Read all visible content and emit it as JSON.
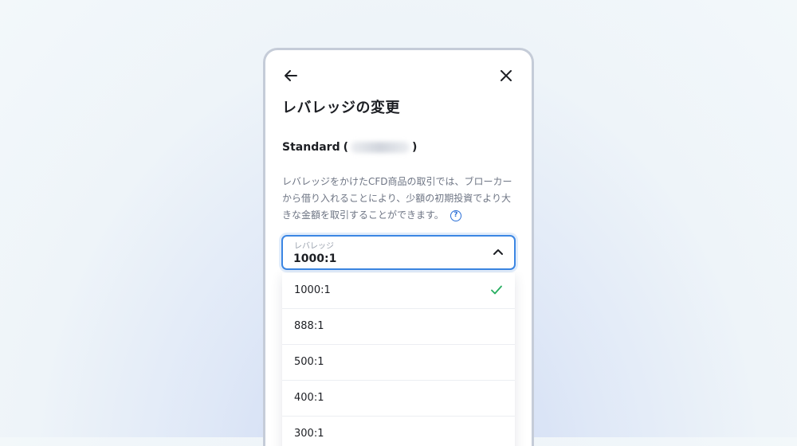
{
  "header": {
    "back_icon": "arrow-left-icon",
    "close_icon": "close-icon",
    "title": "レバレッジの変更"
  },
  "account": {
    "name": "Standard",
    "open_paren": "(",
    "close_paren": ")"
  },
  "description": {
    "text": "レバレッジをかけたCFD商品の取引では、ブローカーから借り入れることにより、少額の初期投資でより大きな金額を取引することができます。",
    "help_icon": "question-circle-icon",
    "help_glyph": "?"
  },
  "leverage_select": {
    "label": "レバレッジ",
    "value": "1000:1",
    "chevron_icon": "chevron-up-icon"
  },
  "options": [
    {
      "label": "1000:1",
      "selected": true
    },
    {
      "label": "888:1",
      "selected": false
    },
    {
      "label": "500:1",
      "selected": false
    },
    {
      "label": "400:1",
      "selected": false
    },
    {
      "label": "300:1",
      "selected": false
    }
  ],
  "colors": {
    "accent": "#3b86e3",
    "check": "#27ae60",
    "help": "#2b6fd6"
  }
}
